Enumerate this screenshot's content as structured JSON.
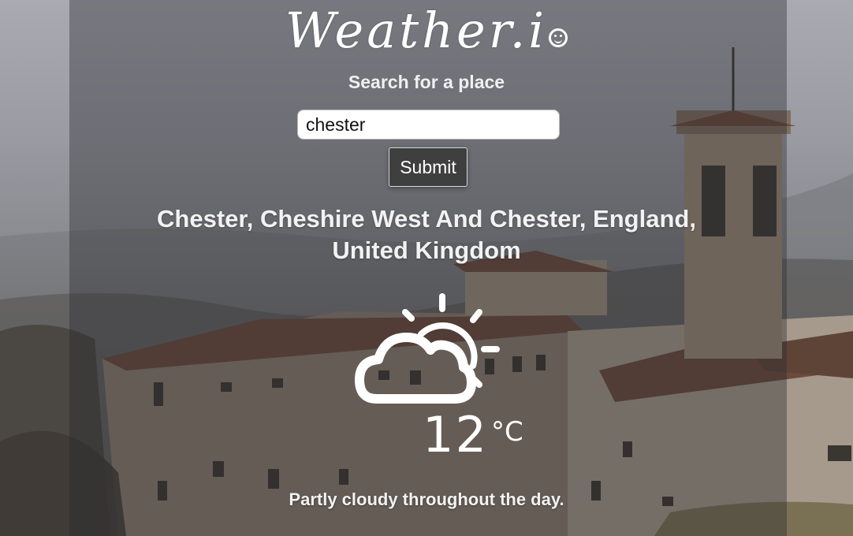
{
  "app": {
    "logo_text": "Weather.io",
    "logo_main": "Weather.i",
    "subtitle": "Search for a place"
  },
  "search": {
    "value": "chester",
    "submit_label": "Submit"
  },
  "result": {
    "location": "Chester, Cheshire West And Chester, England, United Kingdom",
    "condition_icon": "partly-cloudy-day-icon",
    "temperature": "12",
    "unit": "°C",
    "description": "Partly cloudy throughout the day."
  }
}
